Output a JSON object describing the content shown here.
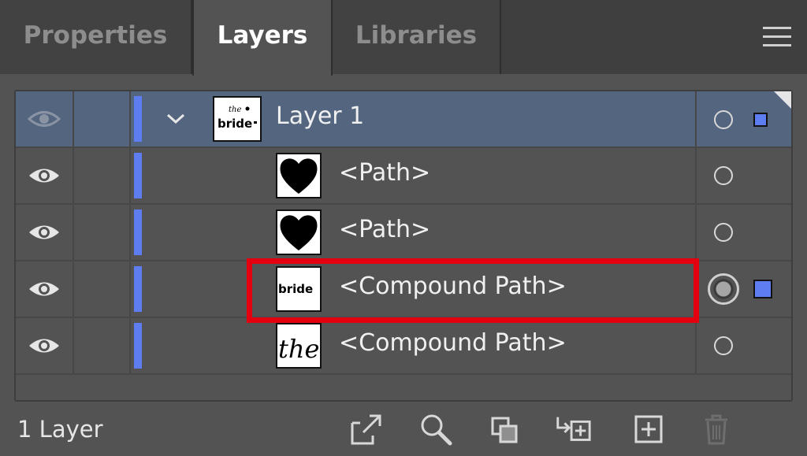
{
  "tabs": [
    {
      "label": "Properties",
      "active": false
    },
    {
      "label": "Layers",
      "active": true
    },
    {
      "label": "Libraries",
      "active": false
    }
  ],
  "panel_menu_icon": "hamburger-menu-icon",
  "layers": [
    {
      "label": "Layer 1",
      "thumbnail": "bride-artwork",
      "level": 0,
      "expanded": true,
      "selected": true,
      "visible": true
    },
    {
      "label": "<Path>",
      "thumbnail": "heart",
      "level": 1,
      "visible": true
    },
    {
      "label": "<Path>",
      "thumbnail": "heart",
      "level": 1,
      "visible": true
    },
    {
      "label": "<Compound Path>",
      "thumbnail": "bride-text",
      "level": 1,
      "visible": true,
      "targeted": true,
      "highlighted": true
    },
    {
      "label": "<Compound Path>",
      "thumbnail": "the-script",
      "level": 1,
      "visible": true
    }
  ],
  "thumb_text": {
    "bride": "bride",
    "the": "the"
  },
  "footer": {
    "layer_count": "1 Layer",
    "icons": [
      "export-icon",
      "search-icon",
      "collect-icon",
      "move-selection-icon",
      "new-layer-icon",
      "trash-icon"
    ]
  },
  "colors": {
    "panel_bg": "#535353",
    "selected_row": "#53657f",
    "layer_color": "#5e7df0",
    "highlight_box": "#e4000f"
  }
}
